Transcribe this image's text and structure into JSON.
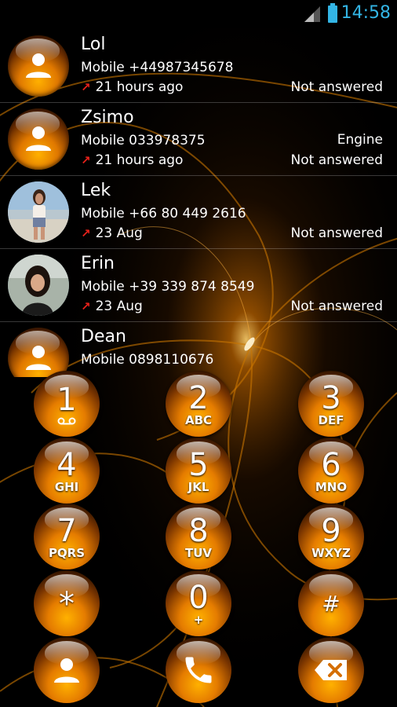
{
  "status_bar": {
    "time": "14:58"
  },
  "call_log": [
    {
      "name": "Lol",
      "number": "Mobile +44987345678",
      "time": "21 hours ago",
      "status": "Not answered",
      "extra": ""
    },
    {
      "name": "Zsimo",
      "number": "Mobile 033978375",
      "time": "21 hours ago",
      "status": "Not answered",
      "extra": "Engine"
    },
    {
      "name": "Lek",
      "number": "Mobile +66 80 449 2616",
      "time": "23 Aug",
      "status": "Not answered",
      "extra": ""
    },
    {
      "name": "Erin",
      "number": "Mobile +39 339 874 8549",
      "time": "23 Aug",
      "status": "Not answered",
      "extra": ""
    },
    {
      "name": "Dean",
      "number": "Mobile 0898110676",
      "time": "",
      "status": "",
      "extra": ""
    }
  ],
  "dialpad": {
    "keys": [
      {
        "digit": "1",
        "letters": ""
      },
      {
        "digit": "2",
        "letters": "ABC"
      },
      {
        "digit": "3",
        "letters": "DEF"
      },
      {
        "digit": "4",
        "letters": "GHI"
      },
      {
        "digit": "5",
        "letters": "JKL"
      },
      {
        "digit": "6",
        "letters": "MNO"
      },
      {
        "digit": "7",
        "letters": "PQRS"
      },
      {
        "digit": "8",
        "letters": "TUV"
      },
      {
        "digit": "9",
        "letters": "WXYZ"
      },
      {
        "digit": "*",
        "letters": ""
      },
      {
        "digit": "0",
        "letters": "+"
      },
      {
        "digit": "#",
        "letters": ""
      }
    ],
    "actions": [
      "contacts-icon",
      "phone-icon",
      "backspace-icon"
    ]
  },
  "colors": {
    "accent": "#33b5e5",
    "orange": "#f08c00",
    "missed_arrow": "#e8211a"
  }
}
